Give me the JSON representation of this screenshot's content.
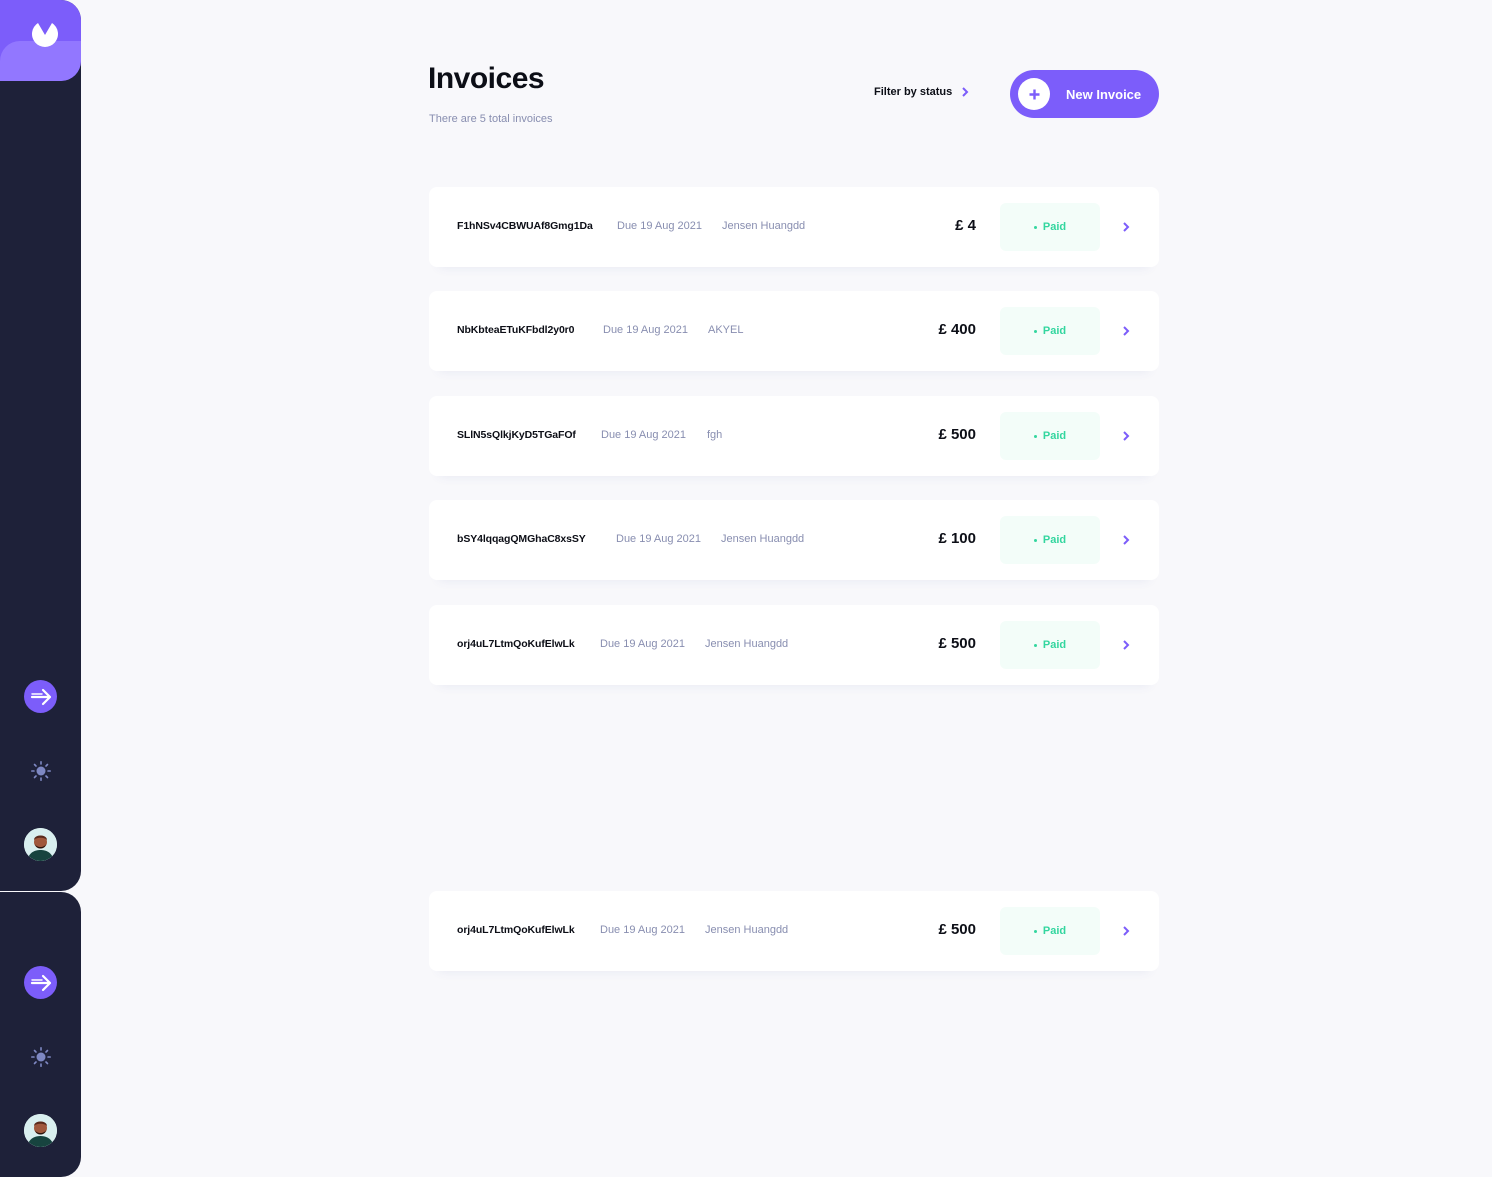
{
  "colors": {
    "accent": "#7c5dfa",
    "sidebar_bg": "#1e2139",
    "paid_green": "#33d69f",
    "muted_text": "#888eb0"
  },
  "sidebar": {
    "logo_icon": "logo-icon",
    "items": [
      {
        "icon": "arrow-right-icon"
      },
      {
        "icon": "sun-icon"
      },
      {
        "icon": "avatar"
      }
    ]
  },
  "header": {
    "title": "Invoices",
    "subtitle": "There are 5 total invoices",
    "filter_label": "Filter by status",
    "new_invoice_label": "New Invoice"
  },
  "invoices": [
    {
      "id": "F1hNSv4CBWUAf8Gmg1Da",
      "due": "Due 19 Aug 2021",
      "client": "Jensen Huangdd",
      "amount": "£ 4",
      "status": "Paid"
    },
    {
      "id": "NbKbteaETuKFbdl2y0r0",
      "due": "Due 19 Aug 2021",
      "client": "AKYEL",
      "amount": "£ 400",
      "status": "Paid"
    },
    {
      "id": "SLlN5sQlkjKyD5TGaFOf",
      "due": "Due 19 Aug 2021",
      "client": "fgh",
      "amount": "£ 500",
      "status": "Paid"
    },
    {
      "id": "bSY4lqqagQMGhaC8xsSY",
      "due": "Due 19 Aug 2021",
      "client": "Jensen Huangdd",
      "amount": "£ 100",
      "status": "Paid"
    },
    {
      "id": "orj4uL7LtmQoKufElwLk",
      "due": "Due 19 Aug 2021",
      "client": "Jensen Huangdd",
      "amount": "£ 500",
      "status": "Paid"
    },
    {
      "id": "orj4uL7LtmQoKufElwLk",
      "due": "Due 19 Aug 2021",
      "client": "Jensen Huangdd",
      "amount": "£ 500",
      "status": "Paid"
    }
  ]
}
